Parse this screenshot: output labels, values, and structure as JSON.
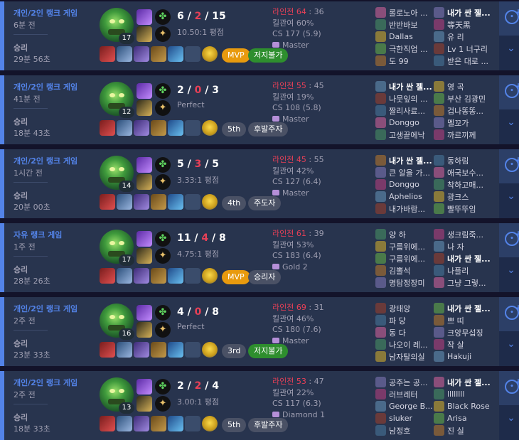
{
  "colors": {
    "accent": "#5383e8",
    "death": "#e84057",
    "mvp": "#e89a0e",
    "badge_gray": "#4a5165",
    "badge_green": "#2e8e2e",
    "win_border": "#5383e8"
  },
  "icons": {
    "ward": "ward-icon",
    "share": "share-icon",
    "expand": "chevron-down-icon",
    "rune": "rune-icon",
    "spell": "summoner-spell-icon",
    "item": "item-icon"
  },
  "matches": [
    {
      "queue": "개인/2인 랭크 게임",
      "ago": "6분 전",
      "result": "승리",
      "length": "29분 56초",
      "level": "17",
      "kills": "6",
      "deaths": "2",
      "assists": "15",
      "ratio": "10.50:1 평점",
      "badge1": "MVP",
      "badge1_color": "#e89a0e",
      "badge2": "저지불가",
      "badge2_color": "#2e8e2e",
      "stats": {
        "pk_label": "라인전",
        "pk_score": "64",
        "pk_rest": " : 36",
        "kp": "킬관여 60%",
        "cs": "CS 177 (5.9)",
        "tier": "Master"
      },
      "team1": [
        {
          "name": "롤로노아 ..."
        },
        {
          "name": "반반바보"
        },
        {
          "name": "Dallas"
        },
        {
          "name": "극한직업 ..."
        },
        {
          "name": "도 99"
        }
      ],
      "team2": [
        {
          "name": "내가 싼 젤...",
          "me": true
        },
        {
          "name": "等天黑"
        },
        {
          "name": "유 리"
        },
        {
          "name": "Lv 1 너구리"
        },
        {
          "name": "받은 대로 ..."
        }
      ]
    },
    {
      "queue": "개인/2인 랭크 게임",
      "ago": "41분 전",
      "result": "승리",
      "length": "18분 43초",
      "level": "12",
      "kills": "2",
      "deaths": "0",
      "assists": "3",
      "ratio": "Perfect",
      "badge1": "5th",
      "badge1_color": "#4a5165",
      "badge2": "후발주자",
      "badge2_color": "#4a5165",
      "stats": {
        "pk_label": "라인전",
        "pk_score": "55",
        "pk_rest": " : 45",
        "kp": "킬관여 19%",
        "cs": "CS 108 (5.8)",
        "tier": "Master"
      },
      "team1": [
        {
          "name": "내가 싼 젤...",
          "me": true
        },
        {
          "name": "나뭇잎의 ..."
        },
        {
          "name": "짤리사료..."
        },
        {
          "name": "Donggo"
        },
        {
          "name": "고생끝에낙"
        }
      ],
      "team2": [
        {
          "name": "영 곡"
        },
        {
          "name": "부산 김광민"
        },
        {
          "name": "겁나똥똥..."
        },
        {
          "name": "멜꼬가"
        },
        {
          "name": "까르끼께"
        }
      ]
    },
    {
      "queue": "개인/2인 랭크 게임",
      "ago": "1시간 전",
      "result": "승리",
      "length": "20분 00초",
      "level": "14",
      "kills": "5",
      "deaths": "3",
      "assists": "5",
      "ratio": "3.33:1 평점",
      "badge1": "4th",
      "badge1_color": "#4a5165",
      "badge2": "주도자",
      "badge2_color": "#4a5165",
      "stats": {
        "pk_label": "라인전",
        "pk_score": "45",
        "pk_rest": " : 55",
        "kp": "킬관여 42%",
        "cs": "CS 127 (6.4)",
        "tier": "Master"
      },
      "team1": [
        {
          "name": "내가 싼 젤...",
          "me": true
        },
        {
          "name": "큰 알을 가..."
        },
        {
          "name": "Donggo"
        },
        {
          "name": "Aphelios"
        },
        {
          "name": "내가바람..."
        }
      ],
      "team2": [
        {
          "name": "동하림"
        },
        {
          "name": "애국보수..."
        },
        {
          "name": "착하고매..."
        },
        {
          "name": "광크스"
        },
        {
          "name": "빨뚜뚜임"
        }
      ]
    },
    {
      "queue": "자유 랭크 게임",
      "ago": "1주 전",
      "result": "승리",
      "length": "28분 26초",
      "level": "17",
      "kills": "11",
      "deaths": "4",
      "assists": "8",
      "ratio": "4.75:1 평점",
      "badge1": "MVP",
      "badge1_color": "#e89a0e",
      "badge2": "승리자",
      "badge2_color": "#4a5165",
      "stats": {
        "pk_label": "라인전",
        "pk_score": "61",
        "pk_rest": " : 39",
        "kp": "킬관여 53%",
        "cs": "CS 183 (6.4)",
        "tier": "Gold 2"
      },
      "team1": [
        {
          "name": "양 하"
        },
        {
          "name": "구름위에..."
        },
        {
          "name": "구름위에..."
        },
        {
          "name": "김뽈석"
        },
        {
          "name": "명탐정장미"
        }
      ],
      "team2": [
        {
          "name": "생크림죽..."
        },
        {
          "name": "나 자"
        },
        {
          "name": "내가 싼 젤...",
          "me": true
        },
        {
          "name": "나플리"
        },
        {
          "name": "그냥 그렇..."
        }
      ]
    },
    {
      "queue": "개인/2인 랭크 게임",
      "ago": "2주 전",
      "result": "승리",
      "length": "23분 33초",
      "level": "16",
      "kills": "4",
      "deaths": "0",
      "assists": "8",
      "ratio": "Perfect",
      "badge1": "3rd",
      "badge1_color": "#4a5165",
      "badge2": "저지불가",
      "badge2_color": "#2e8e2e",
      "stats": {
        "pk_label": "라인전",
        "pk_score": "69",
        "pk_rest": " : 31",
        "kp": "킬관여 46%",
        "cs": "CS 180 (7.6)",
        "tier": "Master"
      },
      "team1": [
        {
          "name": "광태앙"
        },
        {
          "name": "파 당"
        },
        {
          "name": "동 다"
        },
        {
          "name": "나오이 레..."
        },
        {
          "name": "남자탈의실"
        }
      ],
      "team2": [
        {
          "name": "내가 싼 젤...",
          "me": true
        },
        {
          "name": "쁘 띠"
        },
        {
          "name": "크앙무섭징"
        },
        {
          "name": "작 살"
        },
        {
          "name": "Hakuji"
        }
      ]
    },
    {
      "queue": "개인/2인 랭크 게임",
      "ago": "2주 전",
      "result": "승리",
      "length": "18분 33초",
      "level": "13",
      "kills": "2",
      "deaths": "2",
      "assists": "4",
      "ratio": "3.00:1 평점",
      "badge1": "5th",
      "badge1_color": "#4a5165",
      "badge2": "후발주자",
      "badge2_color": "#4a5165",
      "stats": {
        "pk_label": "라인전",
        "pk_score": "53",
        "pk_rest": " : 47",
        "kp": "킬관여 22%",
        "cs": "CS 117 (6.3)",
        "tier": "Diamond 1"
      },
      "team1": [
        {
          "name": "공주는 공..."
        },
        {
          "name": "러브레터"
        },
        {
          "name": "George B..."
        },
        {
          "name": "siuker"
        },
        {
          "name": "남정호"
        }
      ],
      "team2": [
        {
          "name": "내가 싼 젤...",
          "me": true
        },
        {
          "name": "llllllll"
        },
        {
          "name": "Black Rose"
        },
        {
          "name": "Arisa"
        },
        {
          "name": "진 실"
        }
      ]
    }
  ]
}
